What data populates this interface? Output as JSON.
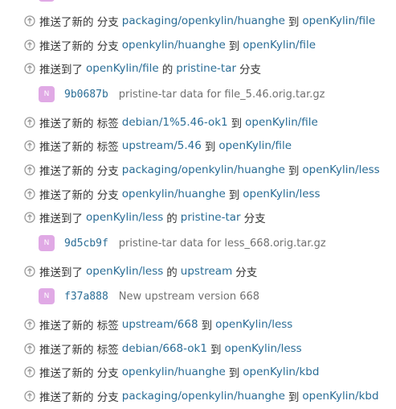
{
  "activities": [
    {
      "prefix": "推送了新的 分支",
      "ref": "packaging/openkylin/huanghe",
      "mid": "到",
      "repo": "openKylin/file",
      "suffix": ""
    },
    {
      "prefix": "推送了新的 分支",
      "ref": "openkylin/huanghe",
      "mid": "到",
      "repo": "openKylin/file",
      "suffix": ""
    },
    {
      "prefix": "推送到了",
      "ref": "openKylin/file",
      "mid": "的",
      "repo": "pristine-tar",
      "suffix": "分支",
      "commit": {
        "avatar": "N",
        "sha": "9b0687b",
        "message": "pristine-tar data for file_5.46.orig.tar.gz"
      }
    },
    {
      "prefix": "推送了新的 标签",
      "ref": "debian/1%5.46-ok1",
      "mid": "到",
      "repo": "openKylin/file",
      "suffix": ""
    },
    {
      "prefix": "推送了新的 标签",
      "ref": "upstream/5.46",
      "mid": "到",
      "repo": "openKylin/file",
      "suffix": ""
    },
    {
      "prefix": "推送了新的 分支",
      "ref": "packaging/openkylin/huanghe",
      "mid": "到",
      "repo": "openKylin/less",
      "suffix": ""
    },
    {
      "prefix": "推送了新的 分支",
      "ref": "openkylin/huanghe",
      "mid": "到",
      "repo": "openKylin/less",
      "suffix": ""
    },
    {
      "prefix": "推送到了",
      "ref": "openKylin/less",
      "mid": "的",
      "repo": "pristine-tar",
      "suffix": "分支",
      "commit": {
        "avatar": "N",
        "sha": "9d5cb9f",
        "message": "pristine-tar data for less_668.orig.tar.gz"
      }
    },
    {
      "prefix": "推送到了",
      "ref": "openKylin/less",
      "mid": "的",
      "repo": "upstream",
      "suffix": "分支",
      "commit": {
        "avatar": "N",
        "sha": "f37a888",
        "message": "New upstream version 668"
      }
    },
    {
      "prefix": "推送了新的 标签",
      "ref": "upstream/668",
      "mid": "到",
      "repo": "openKylin/less",
      "suffix": ""
    },
    {
      "prefix": "推送了新的 标签",
      "ref": "debian/668-ok1",
      "mid": "到",
      "repo": "openKylin/less",
      "suffix": ""
    },
    {
      "prefix": "推送了新的 分支",
      "ref": "openkylin/huanghe",
      "mid": "到",
      "repo": "openKylin/kbd",
      "suffix": ""
    },
    {
      "prefix": "推送了新的 分支",
      "ref": "packaging/openkylin/huanghe",
      "mid": "到",
      "repo": "openKylin/kbd",
      "suffix": ""
    }
  ]
}
